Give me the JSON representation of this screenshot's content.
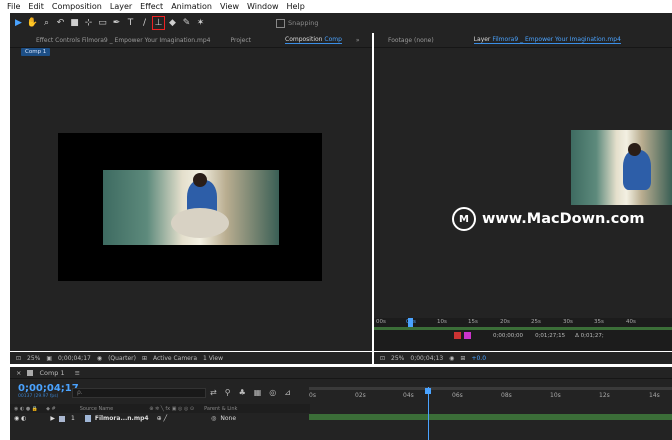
{
  "menu": [
    "File",
    "Edit",
    "Composition",
    "Layer",
    "Effect",
    "Animation",
    "View",
    "Window",
    "Help"
  ],
  "toolbar": {
    "tools": [
      "selection-tool",
      "hand-tool",
      "zoom-tool",
      "rotate-tool",
      "camera-tool",
      "pan-behind-tool",
      "rectangle-tool",
      "pen-tool",
      "type-tool",
      "brush-tool",
      "clone-stamp-tool",
      "eraser-tool",
      "roto-brush-tool",
      "puppet-tool"
    ],
    "selected_tool": "clone-stamp-tool",
    "snapping_label": "Snapping"
  },
  "left_panel": {
    "tab_effect_controls": "Effect Controls Filmora9 _ Empower Your Imagination.mp4",
    "tab_project": "Project",
    "tab_composition_prefix": "Composition",
    "tab_composition_name": "Comp",
    "chip": "Comp 1"
  },
  "right_panel": {
    "tab_footage": "Footage (none)",
    "tab_layer_prefix": "Layer",
    "tab_layer_name": "Filmora9 _ Empower Your Imagination.mp4",
    "ruler_ticks": [
      "00s",
      "05s",
      "10s",
      "15s",
      "20s",
      "25s",
      "30s",
      "35s",
      "40s"
    ]
  },
  "comp_footer": {
    "zoom": "25%",
    "timecode": "0;00;04;17",
    "resolution": "(Quarter)",
    "camera": "Active Camera",
    "view": "1 View"
  },
  "layer_footer": {
    "zoom": "25%",
    "timecode": "0;00;04;13",
    "offset": "+0.0",
    "in_point": "0;00;00;00",
    "out_point": "0;01;27;15",
    "duration": "Δ 0;01;27;"
  },
  "watermark": "www.MacDown.com",
  "timeline": {
    "tab_label": "Comp 1",
    "current_time": "0;00;04;17",
    "current_time_sub": "00137 (29.97 fps)",
    "search_placeholder": "ρ.",
    "columns": {
      "source_name": "Source Name",
      "parent": "Parent & Link"
    },
    "layer": {
      "number": "1",
      "name": "Filmora...n.mp4",
      "parent": "None"
    },
    "ruler_ticks": [
      "0s",
      "02s",
      "04s",
      "06s",
      "08s",
      "10s",
      "12s",
      "14s"
    ]
  }
}
